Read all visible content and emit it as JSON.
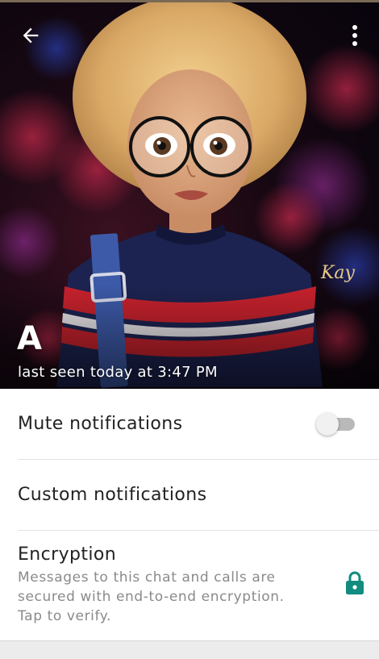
{
  "header": {
    "contact_name": "A",
    "last_seen": "last seen today at 3:47 PM",
    "artwork_signature": "Kay"
  },
  "settings": {
    "mute": {
      "label": "Mute notifications",
      "enabled": false
    },
    "custom": {
      "label": "Custom notifications"
    },
    "encryption": {
      "title": "Encryption",
      "description": "Messages to this chat and calls are secured with end-to-end encryption. Tap to verify."
    }
  },
  "icons": {
    "back": "arrow-left-icon",
    "menu": "more-vertical-icon",
    "lock": "lock-icon"
  },
  "colors": {
    "accent": "#075e54",
    "lock_green": "#128c7e",
    "toggle_off_track": "#b9b9b9",
    "toggle_off_thumb": "#f1f1f1"
  }
}
